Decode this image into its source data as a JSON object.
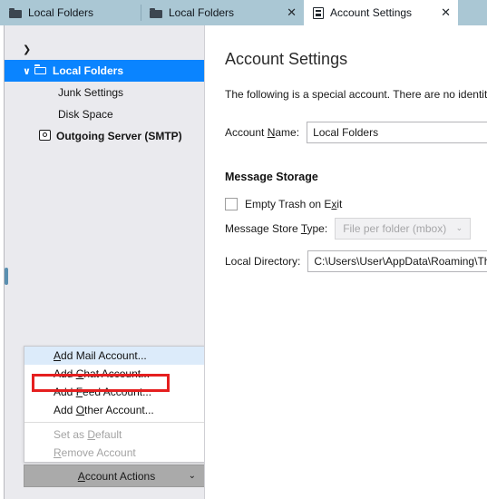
{
  "tabs": [
    {
      "label": "Local Folders",
      "icon": "folder-icon",
      "active": false,
      "closable": false
    },
    {
      "label": "Local Folders",
      "icon": "folder-icon",
      "active": false,
      "closable": true,
      "close_label": "✕"
    },
    {
      "label": "Account Settings",
      "icon": "settings-page-icon",
      "active": true,
      "closable": true,
      "close_label": "✕"
    }
  ],
  "sidebar": {
    "collapsed_row": {
      "twisty": "❯"
    },
    "items": [
      {
        "label": "Local Folders",
        "twisty": "∨",
        "icon": "folder-open-icon",
        "selected": true,
        "bold": true
      },
      {
        "label": "Junk Settings",
        "icon": "",
        "selected": false,
        "bold": false
      },
      {
        "label": "Disk Space",
        "icon": "",
        "selected": false,
        "bold": false
      },
      {
        "label": "Outgoing Server (SMTP)",
        "icon": "smtp-server-icon",
        "selected": false,
        "bold": true
      }
    ]
  },
  "content": {
    "title": "Account Settings",
    "intro": "The following is a special account. There are no identiti",
    "account_name": {
      "label_pre": "Account ",
      "label_key": "N",
      "label_post": "ame:",
      "value": "Local Folders"
    },
    "section_title": "Message Storage",
    "empty_trash": {
      "label_pre": "Empty Trash on E",
      "label_key": "x",
      "label_post": "it",
      "checked": false
    },
    "store_type": {
      "label_pre": "Message Store ",
      "label_key": "T",
      "label_post": "ype:",
      "value": "File per folder (mbox)",
      "caret": "⌄",
      "disabled": true
    },
    "local_directory": {
      "label": "Local Directory:",
      "value": "C:\\Users\\User\\AppData\\Roaming\\Thu"
    }
  },
  "menu": {
    "items": [
      {
        "pre": "",
        "key": "A",
        "post": "dd Mail Account...",
        "full": "Add Mail Account...",
        "disabled": false,
        "highlighted": true,
        "separator_after": false
      },
      {
        "pre": "Add ",
        "key": "C",
        "post": "hat Account...",
        "full": "Add Chat Account...",
        "disabled": false,
        "highlighted": false,
        "separator_after": false
      },
      {
        "pre": "Add ",
        "key": "F",
        "post": "eed Account...",
        "full": "Add Feed Account...",
        "disabled": false,
        "highlighted": false,
        "separator_after": false
      },
      {
        "pre": "Add ",
        "key": "O",
        "post": "ther Account...",
        "full": "Add Other Account...",
        "disabled": false,
        "highlighted": false,
        "separator_after": true
      },
      {
        "pre": "Set as ",
        "key": "D",
        "post": "efault",
        "full": "Set as Default",
        "disabled": true,
        "highlighted": false,
        "separator_after": false
      },
      {
        "pre": "",
        "key": "R",
        "post": "emove Account",
        "full": "Remove Account",
        "disabled": true,
        "highlighted": false,
        "separator_after": false
      }
    ]
  },
  "account_actions": {
    "label_pre": "",
    "label_key": "A",
    "label_post": "ccount Actions",
    "caret": "⌄"
  },
  "colors": {
    "tabbar_bg": "#aac7d4",
    "active_tab_bg": "#ffffff",
    "sidebar_bg": "#eaeaee",
    "selection_blue": "#0a84ff",
    "menu_highlight": "#dcebfa",
    "annotation_red": "#e51f1f",
    "button_grey": "#aaaaaa",
    "disabled_text": "#a3a3a3"
  }
}
